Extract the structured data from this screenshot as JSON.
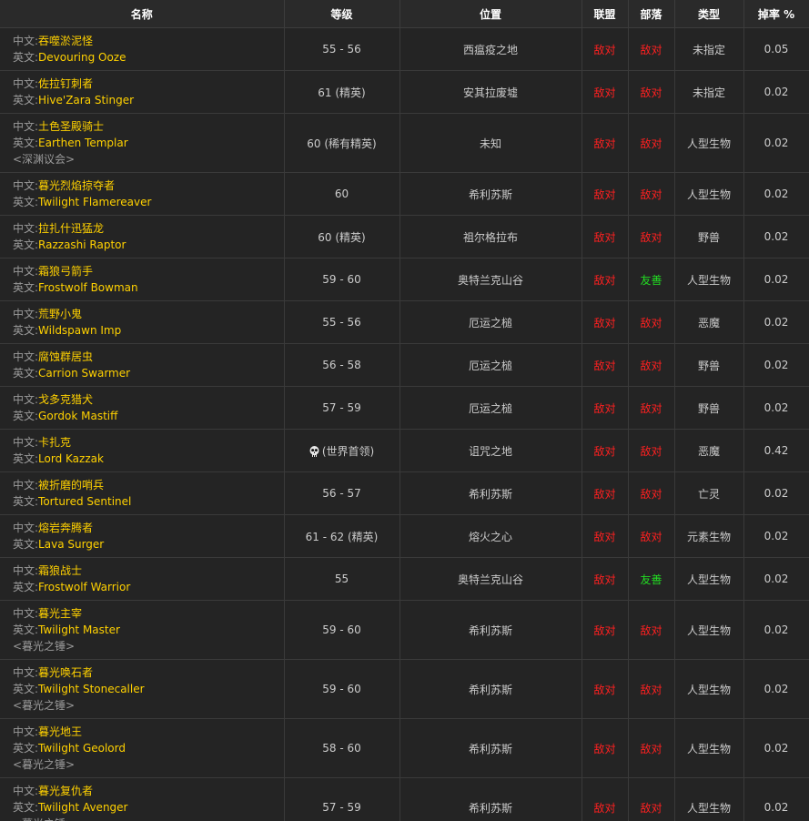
{
  "header": {
    "name": "名称",
    "level": "等级",
    "location": "位置",
    "alliance": "联盟",
    "horde": "部落",
    "type": "类型",
    "drop_rate": "掉率 %"
  },
  "labels": {
    "cn": "中文:",
    "en": "英文:"
  },
  "colors": {
    "hostile": "#ff2020",
    "friendly": "#22dd22",
    "name": "#ffd100"
  },
  "rows": [
    {
      "cn": "吞噬淤泥怪",
      "en": "Devouring Ooze",
      "tag": "",
      "level": "55 - 56",
      "location": "西瘟疫之地",
      "alliance": "敌对",
      "horde": "敌对",
      "type": "未指定",
      "drop": "0.05"
    },
    {
      "cn": "佐拉钉刺者",
      "en": "Hive'Zara Stinger",
      "tag": "",
      "level": "61 (精英)",
      "location": "安其拉废墟",
      "alliance": "敌对",
      "horde": "敌对",
      "type": "未指定",
      "drop": "0.02"
    },
    {
      "cn": "土色圣殿骑士",
      "en": "Earthen Templar",
      "tag": "<深渊议会>",
      "level": "60 (稀有精英)",
      "location": "未知",
      "alliance": "敌对",
      "horde": "敌对",
      "type": "人型生物",
      "drop": "0.02"
    },
    {
      "cn": "暮光烈焰掠夺者",
      "en": "Twilight Flamereaver",
      "tag": "",
      "level": "60",
      "location": "希利苏斯",
      "alliance": "敌对",
      "horde": "敌对",
      "type": "人型生物",
      "drop": "0.02"
    },
    {
      "cn": "拉扎什迅猛龙",
      "en": "Razzashi Raptor",
      "tag": "",
      "level": "60 (精英)",
      "location": "祖尔格拉布",
      "alliance": "敌对",
      "horde": "敌对",
      "type": "野兽",
      "drop": "0.02"
    },
    {
      "cn": "霜狼弓箭手",
      "en": "Frostwolf Bowman",
      "tag": "",
      "level": "59 - 60",
      "location": "奥特兰克山谷",
      "alliance": "敌对",
      "horde": "友善",
      "type": "人型生物",
      "drop": "0.02"
    },
    {
      "cn": "荒野小鬼",
      "en": "Wildspawn Imp",
      "tag": "",
      "level": "55 - 56",
      "location": "厄运之槌",
      "alliance": "敌对",
      "horde": "敌对",
      "type": "恶魔",
      "drop": "0.02"
    },
    {
      "cn": "腐蚀群居虫",
      "en": "Carrion Swarmer",
      "tag": "",
      "level": "56 - 58",
      "location": "厄运之槌",
      "alliance": "敌对",
      "horde": "敌对",
      "type": "野兽",
      "drop": "0.02"
    },
    {
      "cn": "戈多克猎犬",
      "en": "Gordok Mastiff",
      "tag": "",
      "level": "57 - 59",
      "location": "厄运之槌",
      "alliance": "敌对",
      "horde": "敌对",
      "type": "野兽",
      "drop": "0.02"
    },
    {
      "cn": "卡扎克",
      "en": "Lord Kazzak",
      "tag": "",
      "level": "(世界首领)",
      "skull": true,
      "location": "诅咒之地",
      "alliance": "敌对",
      "horde": "敌对",
      "type": "恶魔",
      "drop": "0.42"
    },
    {
      "cn": "被折磨的哨兵",
      "en": "Tortured Sentinel",
      "tag": "",
      "level": "56 - 57",
      "location": "希利苏斯",
      "alliance": "敌对",
      "horde": "敌对",
      "type": "亡灵",
      "drop": "0.02"
    },
    {
      "cn": "熔岩奔腾者",
      "en": "Lava Surger",
      "tag": "",
      "level": "61 - 62 (精英)",
      "location": "熔火之心",
      "alliance": "敌对",
      "horde": "敌对",
      "type": "元素生物",
      "drop": "0.02"
    },
    {
      "cn": "霜狼战士",
      "en": "Frostwolf Warrior",
      "tag": "",
      "level": "55",
      "location": "奥特兰克山谷",
      "alliance": "敌对",
      "horde": "友善",
      "type": "人型生物",
      "drop": "0.02"
    },
    {
      "cn": "暮光主宰",
      "en": "Twilight Master",
      "tag": "<暮光之锤>",
      "level": "59 - 60",
      "location": "希利苏斯",
      "alliance": "敌对",
      "horde": "敌对",
      "type": "人型生物",
      "drop": "0.02"
    },
    {
      "cn": "暮光唤石者",
      "en": "Twilight Stonecaller",
      "tag": "<暮光之锤>",
      "level": "59 - 60",
      "location": "希利苏斯",
      "alliance": "敌对",
      "horde": "敌对",
      "type": "人型生物",
      "drop": "0.02"
    },
    {
      "cn": "暮光地王",
      "en": "Twilight Geolord",
      "tag": "<暮光之锤>",
      "level": "58 - 60",
      "location": "希利苏斯",
      "alliance": "敌对",
      "horde": "敌对",
      "type": "人型生物",
      "drop": "0.02"
    },
    {
      "cn": "暮光复仇者",
      "en": "Twilight Avenger",
      "tag": "<暮光之锤>",
      "level": "57 - 59",
      "location": "希利苏斯",
      "alliance": "敌对",
      "horde": "敌对",
      "type": "人型生物",
      "drop": "0.02"
    }
  ]
}
